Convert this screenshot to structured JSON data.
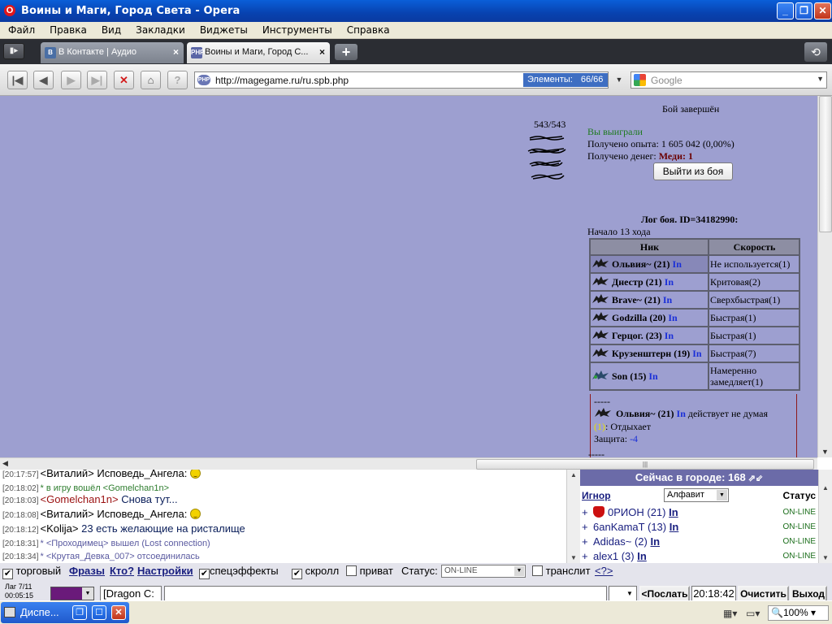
{
  "window": {
    "title": "Воины и Маги, Город Света - Opera"
  },
  "menu": [
    "Файл",
    "Правка",
    "Вид",
    "Закладки",
    "Виджеты",
    "Инструменты",
    "Справка"
  ],
  "tabs": [
    {
      "label": "В Контакте | Аудио",
      "icon": "vk-icon"
    },
    {
      "label": "Воины и Маги, Город С...",
      "icon": "php-icon"
    }
  ],
  "nav": {
    "url": "http://magegame.ru/ru.spb.php",
    "elements_label": "Элементы:",
    "elements_value": "66/66",
    "search_placeholder": "Google"
  },
  "battle": {
    "hp": "543/543",
    "status": "Бой завершён",
    "result": "Вы выиграли",
    "exp": "Получено опыта: 1 605 042 (0,00%)",
    "money_label": "Получено денег:",
    "money_value": "Меди: 1",
    "exit_button": "Выйти из боя",
    "log_id": "Лог боя. ID=34182990:",
    "start": "Начало 13 хода",
    "table_headers": [
      "Ник",
      "Скорость"
    ],
    "participants": [
      {
        "nick": "Ольвия~ (21)",
        "speed": "Не используется(1)"
      },
      {
        "nick": "Днестр (21)",
        "speed": "Критовая(2)"
      },
      {
        "nick": "Brave~ (21)",
        "speed": "Сверхбыстрая(1)"
      },
      {
        "nick": "Godzilla (20)",
        "speed": "Быстрая(1)"
      },
      {
        "nick": "Герцог. (23)",
        "speed": "Быстрая(1)"
      },
      {
        "nick": "Крузенштерн (19)",
        "speed": "Быстрая(7)"
      },
      {
        "nick": "Son (15)",
        "speed": "Намеренно замедляет(1)"
      }
    ],
    "in_label": "In",
    "log": {
      "dashes": "-----",
      "actor": "Ольвия~ (21)",
      "action": "действует не думая",
      "rest_num": "(1)",
      "rest_text": ": Отдыхает",
      "defense_label": "Защита:",
      "defense_value": "-4"
    }
  },
  "chat": [
    {
      "time": "[20:17:57]",
      "nick": "<Виталий>",
      "msg": "Исповедь_Ангела:",
      "smiley": true
    },
    {
      "time": "[20:18:02]",
      "system": "* в игру вошёл <Gomelchan1n>"
    },
    {
      "time": "[20:18:03]",
      "nick": "<Gomelchan1n>",
      "msg": "Снова тут...",
      "red": true
    },
    {
      "time": "[20:18:08]",
      "nick": "<Виталий>",
      "msg": "Исповедь_Ангела:",
      "smiley": true
    },
    {
      "time": "[20:18:12]",
      "nick": "<Kolija>",
      "msg": "23 есть желающие на ристалище"
    },
    {
      "time": "[20:18:31]",
      "system2": "* <Проходимец> вышел (Lost connection)"
    },
    {
      "time": "[20:18:34]",
      "system2": "* <Крутая_Девка_007> отсоединилась"
    }
  ],
  "city": {
    "header": "Сейчас в городе: 168",
    "ignore": "Игнор",
    "sort": "Алфавит",
    "status_header": "Статус",
    "players": [
      {
        "name": "0РИОН",
        "level": "(21)",
        "status": "ON-LINE",
        "emblem": true
      },
      {
        "name": "6anKamaT",
        "level": "(13)",
        "status": "ON-LINE"
      },
      {
        "name": "Adidas~",
        "level": "(2)",
        "status": "ON-LINE"
      },
      {
        "name": "alex1",
        "level": "(3)",
        "status": "ON-LINE"
      }
    ],
    "in_label": "In",
    "plus": "+"
  },
  "options": {
    "trade": "торговый",
    "phrases": "Фразы",
    "who": "Кто?",
    "settings": "Настройки",
    "effects": "спецэффекты",
    "scroll": "скролл",
    "private": "приват",
    "status_label": "Статус:",
    "status_value": "ON-LINE",
    "translit": "транслит",
    "help": "<?>"
  },
  "input": {
    "lag": "Лаг 7/11",
    "lag_time": "00:05:15",
    "target": "[Dragon C:",
    "send": "<Послать",
    "clock": "20:18:42",
    "clear": "Очистить",
    "exit": "Выход"
  },
  "taskbar": {
    "task": "Диспе...",
    "zoom": "100%"
  },
  "colors": {
    "content_bg": "#9d9fd0",
    "title_bar": "#0a5fd8",
    "tab_bar": "#2b2d33"
  }
}
